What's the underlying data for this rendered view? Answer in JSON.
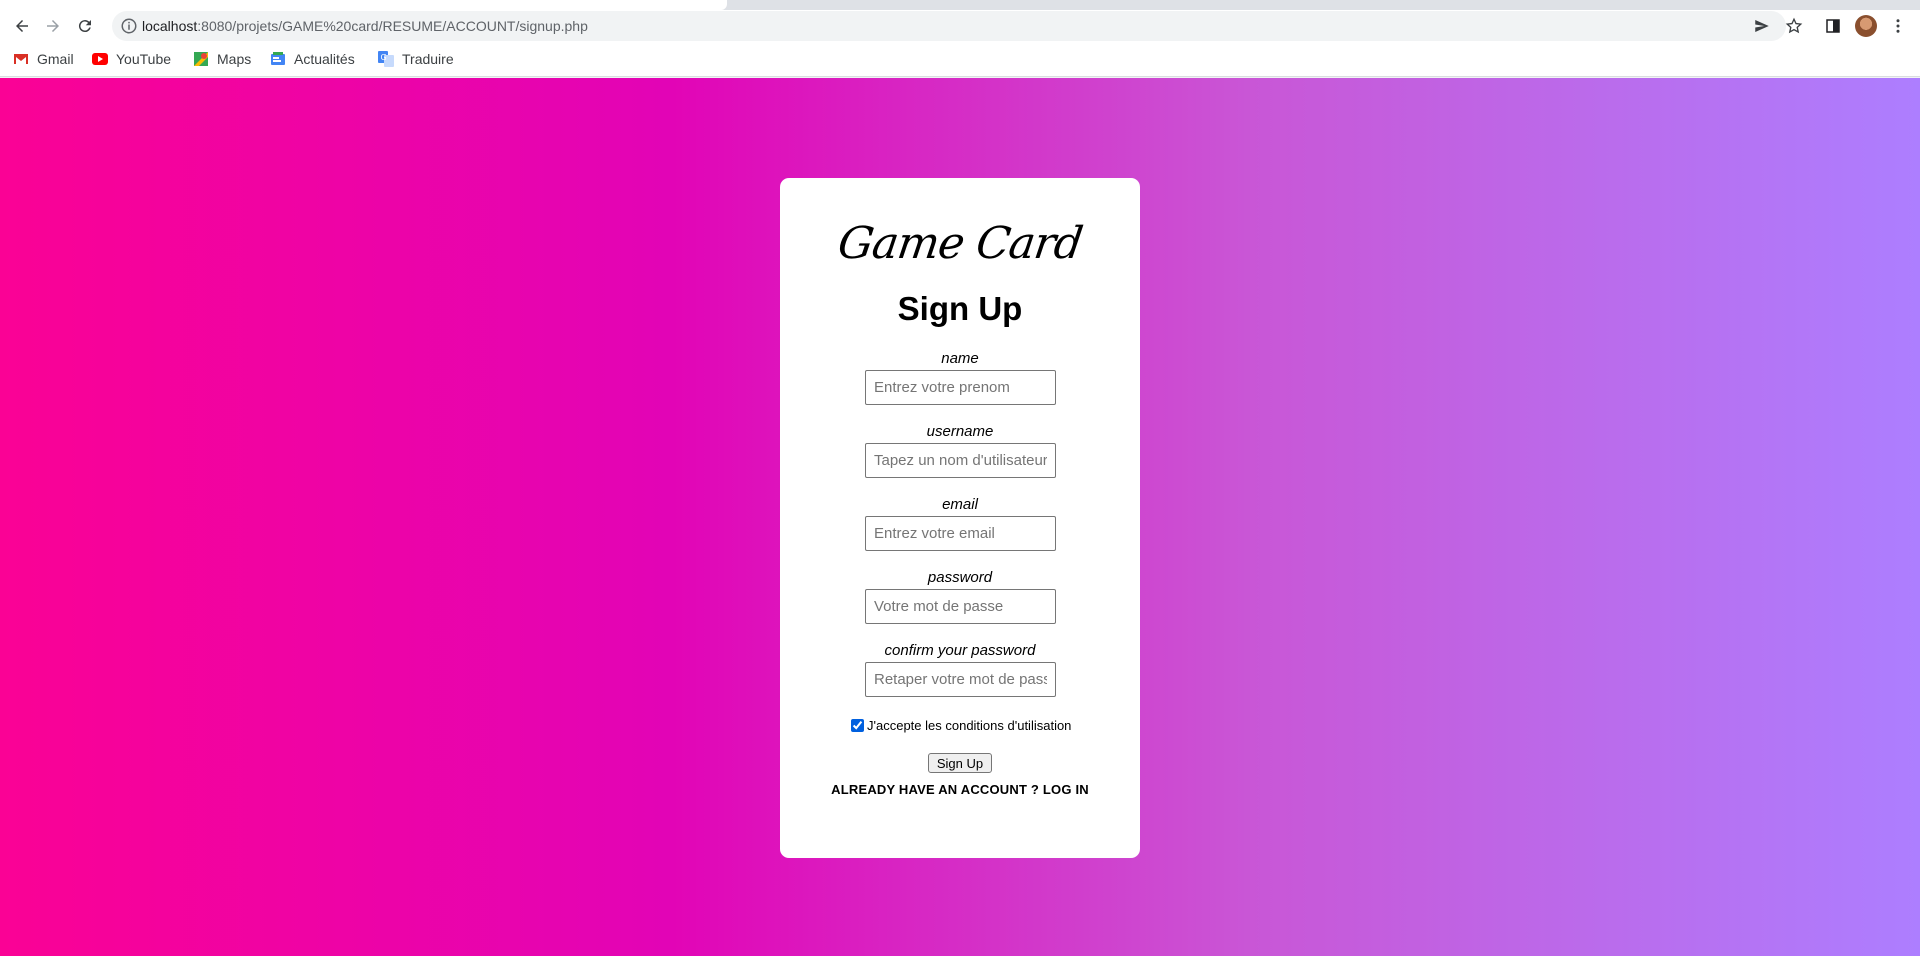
{
  "browser": {
    "url_host": "localhost",
    "url_path": ":8080/projets/GAME%20card/RESUME/ACCOUNT/signup.php",
    "bookmarks": [
      {
        "label": "Gmail",
        "icon": "gmail-icon",
        "color": "#d93025"
      },
      {
        "label": "YouTube",
        "icon": "youtube-icon",
        "color": "#ff0000"
      },
      {
        "label": "Maps",
        "icon": "maps-icon",
        "color": "#34a853"
      },
      {
        "label": "Actualités",
        "icon": "news-icon",
        "color": "#4285f4"
      },
      {
        "label": "Traduire",
        "icon": "translate-icon",
        "color": "#4285f4"
      }
    ]
  },
  "page": {
    "background_gradient": [
      "#fa0295",
      "#e204b6",
      "#c956d6",
      "#ad7eff"
    ]
  },
  "form": {
    "brand": "Game Card",
    "title": "Sign Up",
    "fields": [
      {
        "label": "name",
        "placeholder": "Entrez votre prenom",
        "value": ""
      },
      {
        "label": "username",
        "placeholder": "Tapez un nom d'utilisateur",
        "value": ""
      },
      {
        "label": "email",
        "placeholder": "Entrez votre email",
        "value": ""
      },
      {
        "label": "password",
        "placeholder": "Votre mot de passe",
        "value": ""
      },
      {
        "label": "confirm your password",
        "placeholder": "Retaper votre mot de passe",
        "value": ""
      }
    ],
    "terms_label": "J'accepte les conditions d'utilisation",
    "terms_checked": true,
    "submit_label": "Sign Up",
    "login_link": "ALREADY HAVE AN ACCOUNT ? LOG IN"
  }
}
